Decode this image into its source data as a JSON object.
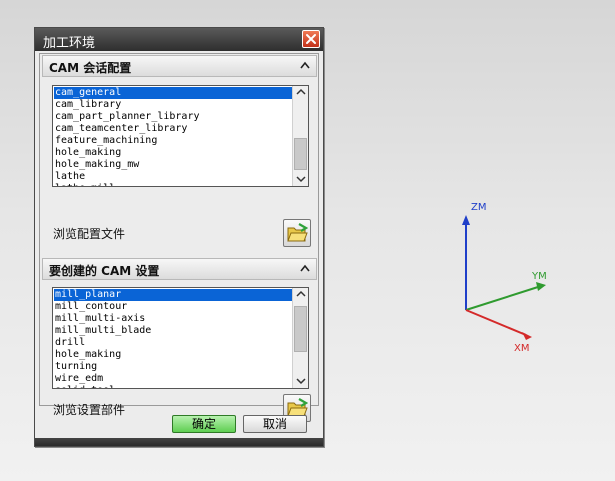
{
  "dialog": {
    "title": "加工环境",
    "ok_label": "确定",
    "cancel_label": "取消"
  },
  "section1": {
    "title": "CAM 会话配置",
    "items": [
      "cam_general",
      "cam_library",
      "cam_part_planner_library",
      "cam_teamcenter_library",
      "feature_machining",
      "hole_making",
      "hole_making_mw",
      "lathe",
      "lathe_mill"
    ],
    "selected": "cam_general",
    "browse_label": "浏览配置文件"
  },
  "section2": {
    "title": "要创建的 CAM 设置",
    "items": [
      "mill_planar",
      "mill_contour",
      "mill_multi-axis",
      "mill_multi_blade",
      "drill",
      "hole_making",
      "turning",
      "wire_edm",
      "solid_tool"
    ],
    "selected": "mill_planar",
    "browse_label": "浏览设置部件"
  },
  "triad": {
    "x_label": "XM",
    "y_label": "YM",
    "z_label": "ZM",
    "x_color": "#d42a2a",
    "y_color": "#2f9b2f",
    "z_color": "#1f3fc9"
  },
  "icons": [
    "close-icon",
    "collapse-up-icon",
    "open-folder-icon",
    "scroll-up-icon",
    "scroll-down-icon"
  ]
}
